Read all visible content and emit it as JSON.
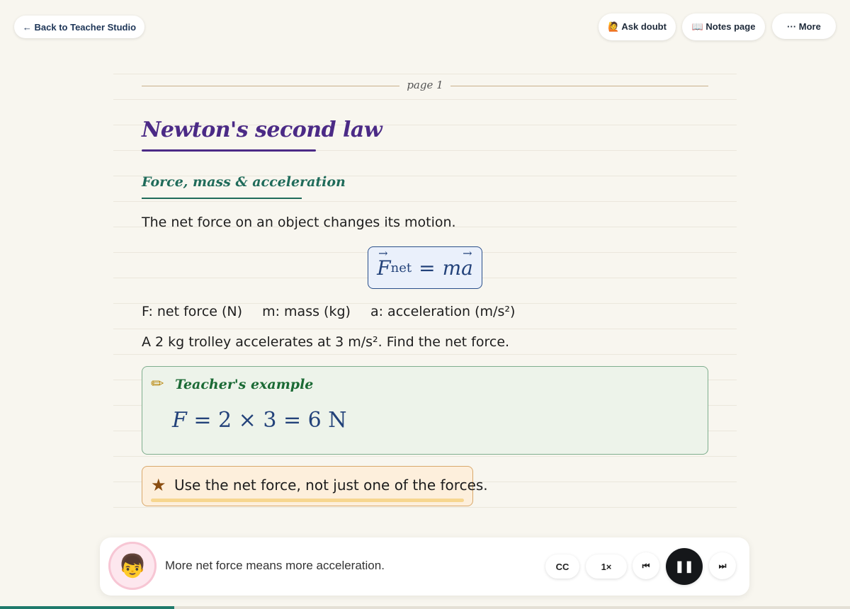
{
  "top_bar": {
    "back_label": "← Back to Teacher Studio",
    "ask_label": "🙋 Ask doubt",
    "notes_label": "📖 Notes page",
    "more_label": "··· More"
  },
  "page": {
    "label": "page 1",
    "title": "Newton's second law",
    "section_heading": "Force, mass & acceleration",
    "intro": "The net force on an object changes its motion.",
    "formula": {
      "F": "F",
      "sub": "net",
      "rhs_m": "m",
      "rhs_a": "a",
      "eq": "="
    },
    "variables": [
      "F: net force (N)",
      "m: mass (kg)",
      "a: acceleration (m/s²)"
    ],
    "problem": "A 2 kg trolley accelerates at 3 m/s². Find the net force.",
    "example": {
      "icon": "pencil-icon",
      "label": "Teacher's example",
      "equation_lhs": "F",
      "equation_rhs": " = 2 × 3 = 6 N"
    },
    "tip": {
      "icon": "star-icon",
      "text": "Use the net force, not just one of the forces."
    }
  },
  "player": {
    "narration": "More net force means more acceleration.",
    "cc_label": "CC",
    "speed_label": "1×",
    "prev_symbol": "⏮",
    "pause_symbol": "❚❚",
    "next_symbol": "⏭",
    "avatar_glyph": "👦",
    "progress": 0.205
  },
  "colors": {
    "title": "#4b2a86",
    "section": "#1f6b5a",
    "progress": "#1f7a6b"
  }
}
